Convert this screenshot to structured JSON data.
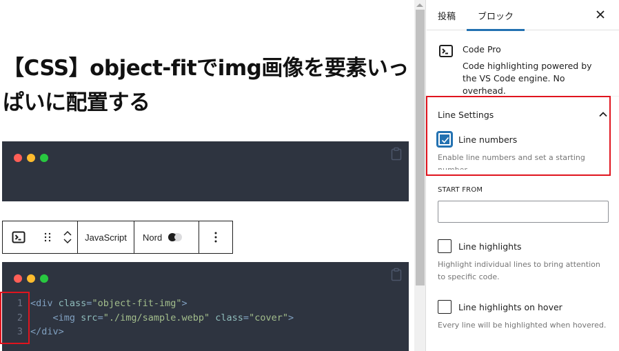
{
  "editor": {
    "post_title": "【CSS】object-fitでimg画像を要素いっぱいに配置する",
    "code_blocks": [
      {
        "lines": []
      },
      {
        "lines": [
          {
            "number": "1",
            "tokens": [
              {
                "type": "tag",
                "text": "<div"
              },
              {
                "type": "plain",
                "text": " "
              },
              {
                "type": "attr",
                "text": "class"
              },
              {
                "type": "eq",
                "text": "="
              },
              {
                "type": "str",
                "text": "\"object-fit-img\""
              },
              {
                "type": "tag",
                "text": ">"
              }
            ]
          },
          {
            "number": "2",
            "tokens": [
              {
                "type": "plain",
                "text": "    "
              },
              {
                "type": "tag",
                "text": "<img"
              },
              {
                "type": "plain",
                "text": " "
              },
              {
                "type": "attr",
                "text": "src"
              },
              {
                "type": "eq",
                "text": "="
              },
              {
                "type": "str",
                "text": "\"./img/sample.webp\""
              },
              {
                "type": "plain",
                "text": " "
              },
              {
                "type": "attr",
                "text": "class"
              },
              {
                "type": "eq",
                "text": "="
              },
              {
                "type": "str",
                "text": "\"cover\""
              },
              {
                "type": "tag",
                "text": ">"
              }
            ]
          },
          {
            "number": "3",
            "tokens": [
              {
                "type": "tag",
                "text": "</div>"
              }
            ]
          }
        ]
      }
    ],
    "window_dot_colors": {
      "red": "#ff5f57",
      "yellow": "#febc2e",
      "green": "#28c840"
    },
    "code_background": "#2e3440"
  },
  "block_toolbar": {
    "block_icon": "terminal-icon",
    "drag_icon": "drag-handle-icon",
    "move_up_icon": "chevron-up-icon",
    "move_down_icon": "chevron-down-icon",
    "language_label": "JavaScript",
    "theme_label": "Nord",
    "theme_toggle_icon": "toggle-icon",
    "more_icon": "more-vertical-icon"
  },
  "sidebar": {
    "tabs": [
      {
        "label": "投稿",
        "active": false
      },
      {
        "label": "ブロック",
        "active": true
      }
    ],
    "close_icon": "close-icon",
    "block_card": {
      "icon": "terminal-icon",
      "title": "Code Pro",
      "description": "Code highlighting powered by the VS Code engine. No overhead."
    },
    "line_settings": {
      "title": "Line Settings",
      "expanded": true,
      "line_numbers": {
        "label": "Line numbers",
        "checked": true,
        "help": "Enable line numbers and set a starting number."
      },
      "start_from": {
        "label": "START FROM",
        "value": "",
        "placeholder": ""
      },
      "line_highlights": {
        "label": "Line highlights",
        "checked": false,
        "help": "Highlight individual lines to bring attention to specific code."
      },
      "line_highlights_hover": {
        "label": "Line highlights on hover",
        "checked": false,
        "help": "Every line will be highlighted when hovered."
      }
    },
    "accent_color": "#2271b1"
  },
  "annotations": {
    "highlight_color": "#e0141e"
  }
}
